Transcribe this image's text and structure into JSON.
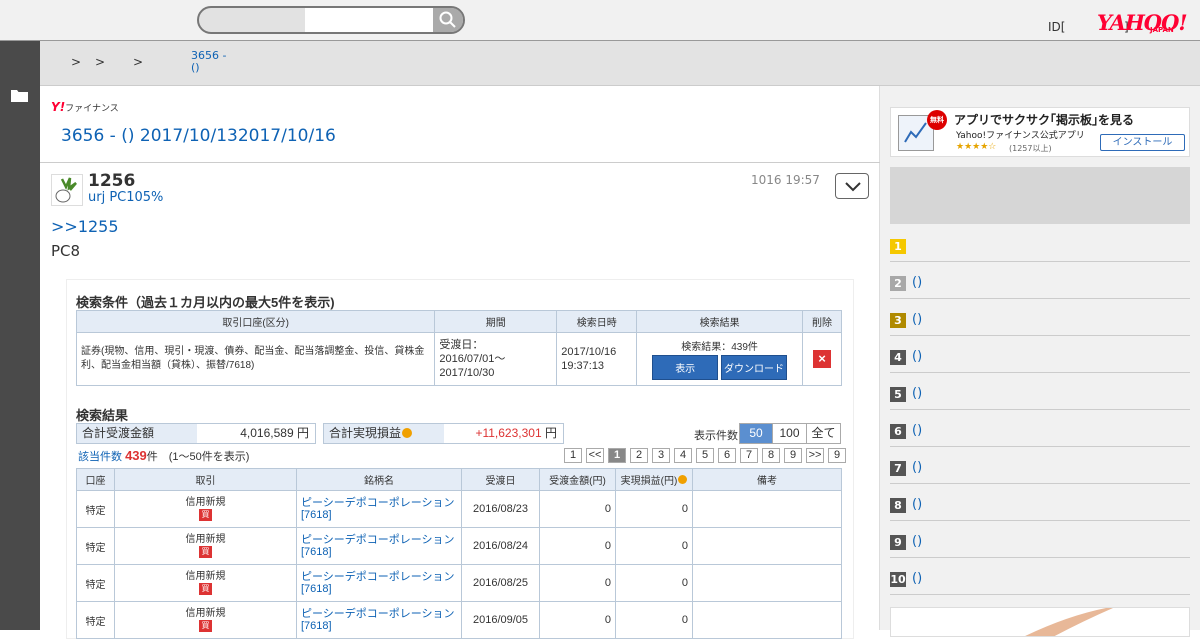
{
  "header": {
    "search_placeholder": "",
    "id_text": "ID[",
    "bracket_text": "]",
    "logo": "YAHOO!",
    "logo_sub": "JAPAN"
  },
  "breadcrumb": {
    "sep1": ">",
    "sep2": ">",
    "sep3": ">",
    "current_line1": "3656 -",
    "current_line2": "()"
  },
  "board": {
    "brand_mark": "Y!",
    "brand_text": "ファイナンス",
    "title": "3656 - () 2017/10/132017/10/16"
  },
  "post": {
    "number": "1256",
    "user": "urj PC105%",
    "date": "1016 19:57",
    "reply_link": ">>1255",
    "text": "PC8"
  },
  "shot": {
    "cond_title": "検索条件（過去１カ月以内の最大5件を表示)",
    "cond_headers": [
      "取引口座(区分)",
      "期間",
      "検索日時",
      "検索結果",
      "削除"
    ],
    "cond_account": "証券(現物、信用、現引・現渡、債券、配当金、配当落調整金、投信、貸株金利、配当金相当額（貸株）、振替/7618)",
    "cond_period_1": "受渡日：",
    "cond_period_2": "2016/07/01〜",
    "cond_period_3": "2017/10/30",
    "cond_date_1": "2017/10/16",
    "cond_date_2": "19:37:13",
    "cond_result": "検索結果：439件",
    "show_btn": "表示",
    "download_btn": "ダウンロード",
    "delete_icon": "×",
    "result_title": "検索結果",
    "total_recv_label": "合計受渡金額",
    "total_recv_value": "4,016,589",
    "total_pl_label": "合計実現損益",
    "total_pl_value": "+11,623,301",
    "yen": "円",
    "per_page_label": "表示件数",
    "per_page_opts": [
      "50",
      "100",
      "全て"
    ],
    "hits_label": "該当件数",
    "hits_count": "439",
    "hits_unit": "件",
    "hits_range": "(1〜50件を表示)",
    "pages": [
      "1",
      "<<",
      "1",
      "2",
      "3",
      "4",
      "5",
      "6",
      "7",
      "8",
      "9",
      ">>",
      "9"
    ],
    "table_headers": [
      "口座",
      "取引",
      "銘柄名",
      "受渡日",
      "受渡金額(円)",
      "実現損益(円)",
      "備考"
    ],
    "rows": [
      {
        "acct": "特定",
        "trade": "信用新規",
        "badge": "買",
        "name": "ピーシーデポコーポレーション",
        "code": "[7618]",
        "date": "2016/08/23",
        "amount": "0",
        "pl": "0"
      },
      {
        "acct": "特定",
        "trade": "信用新規",
        "badge": "買",
        "name": "ピーシーデポコーポレーション",
        "code": "[7618]",
        "date": "2016/08/24",
        "amount": "0",
        "pl": "0"
      },
      {
        "acct": "特定",
        "trade": "信用新規",
        "badge": "買",
        "name": "ピーシーデポコーポレーション",
        "code": "[7618]",
        "date": "2016/08/25",
        "amount": "0",
        "pl": "0"
      },
      {
        "acct": "特定",
        "trade": "信用新規",
        "badge": "買",
        "name": "ピーシーデポコーポレーション",
        "code": "[7618]",
        "date": "2016/09/05",
        "amount": "0",
        "pl": "0"
      }
    ]
  },
  "sidebar": {
    "app_free": "無料",
    "app_title": "アプリでサクサク｢掲示板｣を見る",
    "app_sub": "Yahoo!ファイナンス公式アプリ",
    "app_stars": "★★★★☆",
    "app_count": "(1257以上)",
    "install": "インストール",
    "ranking": [
      {
        "num": "1",
        "text": "",
        "color": "#f5c800"
      },
      {
        "num": "2",
        "text": "()",
        "color": "#a8a8a8"
      },
      {
        "num": "3",
        "text": "()",
        "color": "#b08a00"
      },
      {
        "num": "4",
        "text": "()",
        "color": "#555555"
      },
      {
        "num": "5",
        "text": "()",
        "color": "#555555"
      },
      {
        "num": "6",
        "text": "()",
        "color": "#555555"
      },
      {
        "num": "7",
        "text": "()",
        "color": "#555555"
      },
      {
        "num": "8",
        "text": "()",
        "color": "#555555"
      },
      {
        "num": "9",
        "text": "()",
        "color": "#555555"
      },
      {
        "num": "10",
        "text": "()",
        "color": "#555555"
      }
    ]
  },
  "colors": {
    "link": "#0e62b4",
    "brand": "#ff0033",
    "sidebar_dark": "#4a4a4a"
  }
}
